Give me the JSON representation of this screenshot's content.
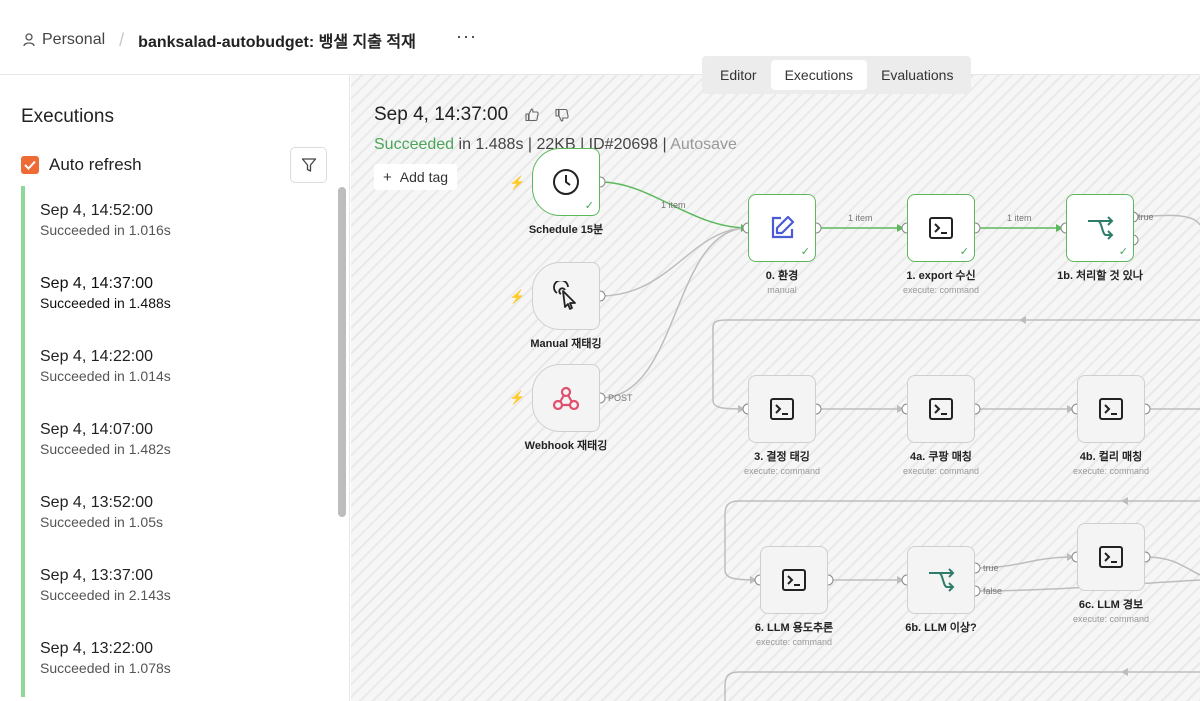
{
  "header": {
    "owner": "Personal",
    "workflow_name": "banksalad-autobudget: 뱅샐 지출 적재",
    "more": "···",
    "tabs": [
      "Editor",
      "Executions",
      "Evaluations"
    ]
  },
  "sidebar": {
    "title": "Executions",
    "auto_refresh_label": "Auto refresh",
    "auto_refresh_checked": true,
    "executions": [
      {
        "time": "Sep 4, 14:52:00",
        "status": "Succeeded in 1.016s"
      },
      {
        "time": "Sep 4, 14:37:00",
        "status": "Succeeded in 1.488s"
      },
      {
        "time": "Sep 4, 14:22:00",
        "status": "Succeeded in 1.014s"
      },
      {
        "time": "Sep 4, 14:07:00",
        "status": "Succeeded in 1.482s"
      },
      {
        "time": "Sep 4, 13:52:00",
        "status": "Succeeded in 1.05s"
      },
      {
        "time": "Sep 4, 13:37:00",
        "status": "Succeeded in 2.143s"
      },
      {
        "time": "Sep 4, 13:22:00",
        "status": "Succeeded in 1.078s"
      }
    ]
  },
  "execution": {
    "title": "Sep 4, 14:37:00",
    "status_word": "Succeeded",
    "details": " in 1.488s | 22KB | ID#20698 | ",
    "autosave": "Autosave",
    "add_tag": "Add tag"
  },
  "nodes": {
    "schedule": "Schedule 15분",
    "manual": "Manual 재태깅",
    "webhook": "Webhook 재태깅",
    "env": "0. 환경",
    "env_sub": "manual",
    "export": "1. export 수신",
    "export_sub": "execute: command",
    "check": "1b. 처리할 것 있나",
    "tag": "3. 결정 태깅",
    "tag_sub": "execute: command",
    "coupang": "4a. 쿠팡 매칭",
    "coupang_sub": "execute: command",
    "kurly": "4b. 컬리 매칭",
    "kurly_sub": "execute: command",
    "llm_use": "6. LLM 용도추론",
    "llm_use_sub": "execute: command",
    "llm_anom": "6b. LLM 이상?",
    "llm_alert": "6c. LLM 경보",
    "llm_alert_sub": "execute: command"
  },
  "edges": {
    "one_item": "1 item",
    "post": "POST",
    "true": "true",
    "false": "false"
  },
  "colors": {
    "accent": "#ee6b36",
    "success": "#5cb85c",
    "success_bar": "#8ed89b",
    "webhook": "#e0506e",
    "edit": "#4b5bd6"
  }
}
